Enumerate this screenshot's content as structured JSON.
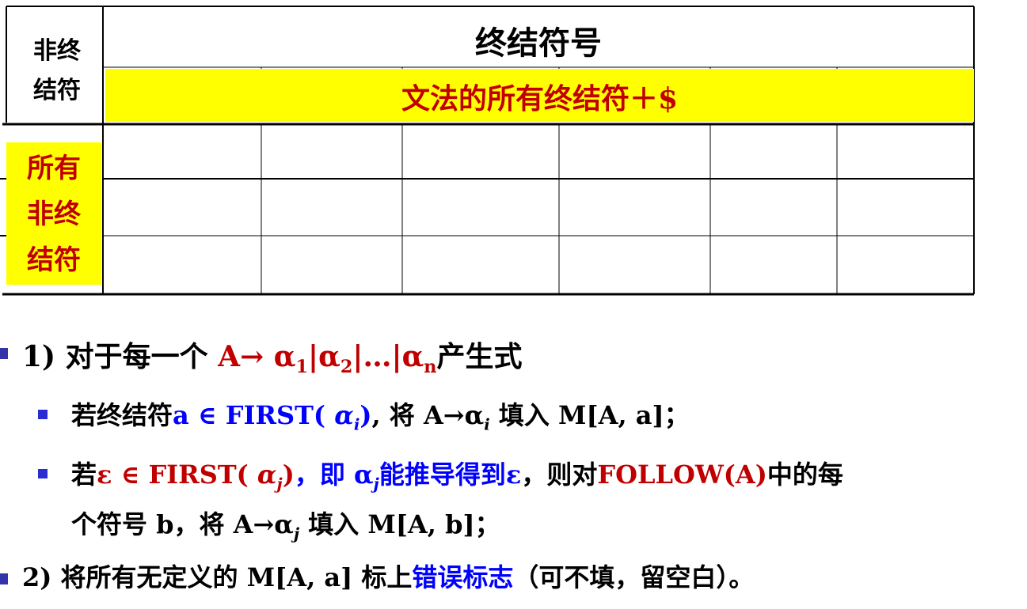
{
  "table": {
    "header_nonterminal": "非终\n结符",
    "header_terminal": "终结符号",
    "terminal_row_label": "文法的所有终结符＋$",
    "nonterminal_col_label": "所有\n非终\n结符"
  },
  "bullets": {
    "b1": {
      "prefix": "1) 对于每一个 ",
      "red_part": "A→ α",
      "s1": "1",
      "p1": "|α",
      "s2": "2",
      "p2": "|…|α",
      "sn": "n",
      "suffix": "产生式"
    },
    "b2": {
      "p1": "若终结符",
      "blue1": "a ∈ FIRST( ",
      "blue_alpha": "α",
      "blue_sub": "i",
      "blue2": ")",
      "p2": ", 将 A→α",
      "sub_i": "i",
      "p3": " 填入 M[A, a]；"
    },
    "b3": {
      "p1": "若",
      "red1": "ε ∈ FIRST( ",
      "red_alpha": "α",
      "red_sub": "j",
      "red2": ")",
      "p2": "，",
      "blue1": "即 α",
      "blue_sub": "j",
      "blue2": "能推导得到ε",
      "p3": "，则对",
      "red3": "FOLLOW(A)",
      "p4": "中的每"
    },
    "b3b": {
      "p1": "个符号 b，将 A→α",
      "sub": "j",
      "p2": " 填入 M[A, b]；"
    },
    "b4": {
      "p1": "2) 将所有无定义的 M[A, a] 标上",
      "blue": "错误标志",
      "p2": "（可不填，留空白）。"
    }
  }
}
